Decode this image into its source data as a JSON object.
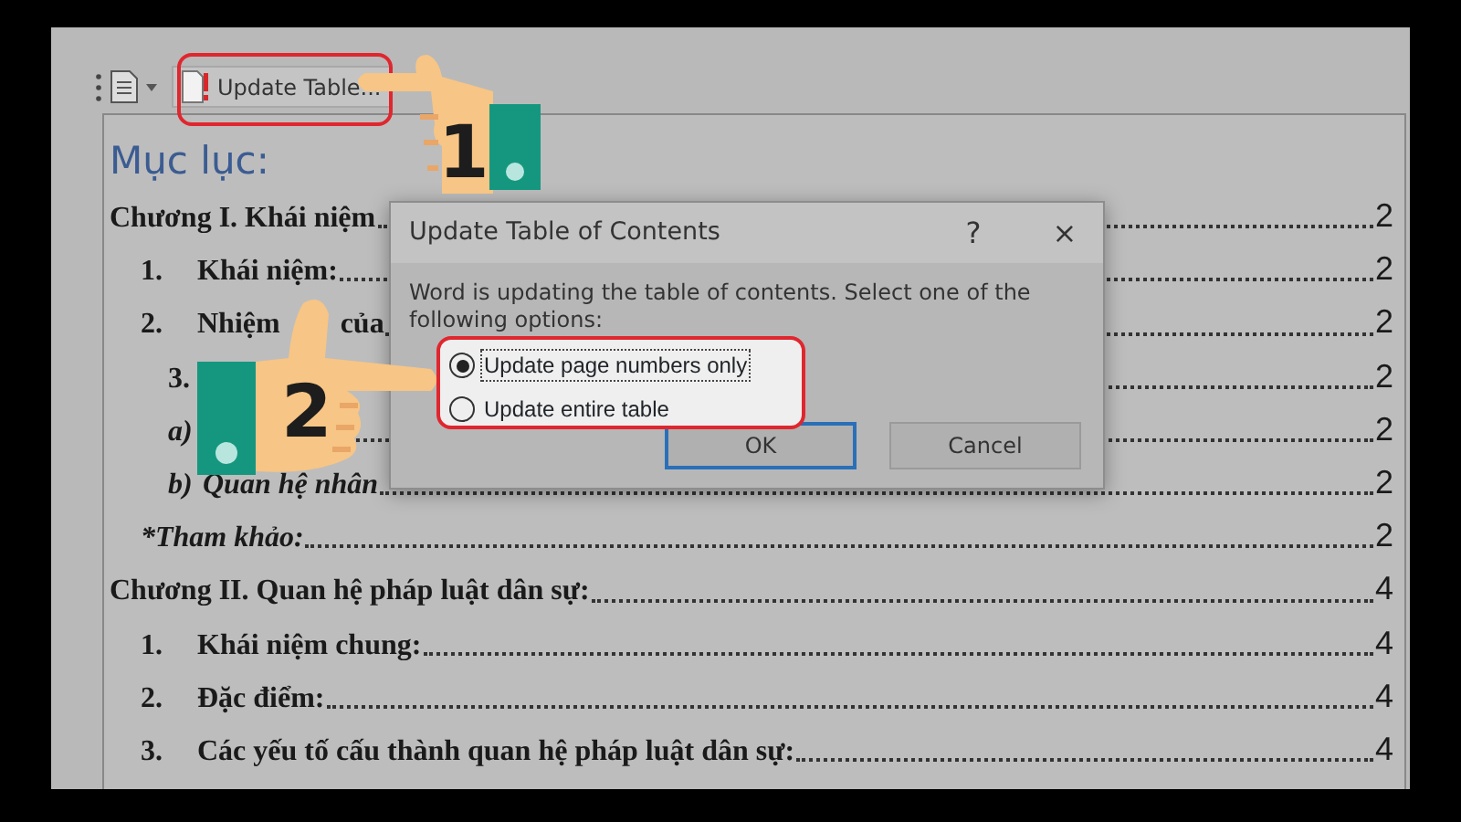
{
  "toolbar": {
    "button": {
      "label": "Update Table..."
    }
  },
  "heading": "Mục lục:",
  "toc": [
    {
      "kind": "chapter",
      "parts": [
        "Chương I. Khái niệm"
      ],
      "page": "2"
    },
    {
      "kind": "section",
      "number": "1.",
      "parts": [
        "Khái niệm:"
      ],
      "page": "2"
    },
    {
      "kind": "section",
      "number": "2.",
      "parts": [
        "Nhiệm",
        "của"
      ],
      "page": "2"
    },
    {
      "kind": "subsection",
      "number": "3.",
      "page": "2"
    },
    {
      "kind": "item",
      "number": "a)",
      "page": "2"
    },
    {
      "kind": "item",
      "number": "b)",
      "parts": [
        "Quan hệ nhân"
      ],
      "page": "2"
    },
    {
      "kind": "note",
      "parts": [
        "*Tham khảo:"
      ],
      "page": "2"
    },
    {
      "kind": "chapter",
      "parts": [
        "Chương II. Quan hệ pháp luật dân sự:"
      ],
      "page": "4"
    },
    {
      "kind": "section",
      "number": "1.",
      "parts": [
        "Khái niệm chung:"
      ],
      "page": "4"
    },
    {
      "kind": "section",
      "number": "2.",
      "parts": [
        "Đặc điểm:"
      ],
      "page": "4"
    },
    {
      "kind": "section",
      "number": "3.",
      "parts": [
        "Các yếu tố cấu thành quan hệ pháp luật dân sự:"
      ],
      "page": "4"
    }
  ],
  "dialog": {
    "title": "Update Table of Contents",
    "help": "?",
    "close": "×",
    "message": "Word is updating the table of contents.  Select one of the following options:",
    "options": [
      {
        "label": "Update page numbers only",
        "selected": true
      },
      {
        "label": "Update entire table",
        "selected": false
      }
    ],
    "buttons": [
      {
        "label": "OK",
        "default": true
      },
      {
        "label": "Cancel",
        "default": false
      }
    ]
  },
  "steps": [
    {
      "label": "1"
    },
    {
      "label": "2"
    }
  ]
}
